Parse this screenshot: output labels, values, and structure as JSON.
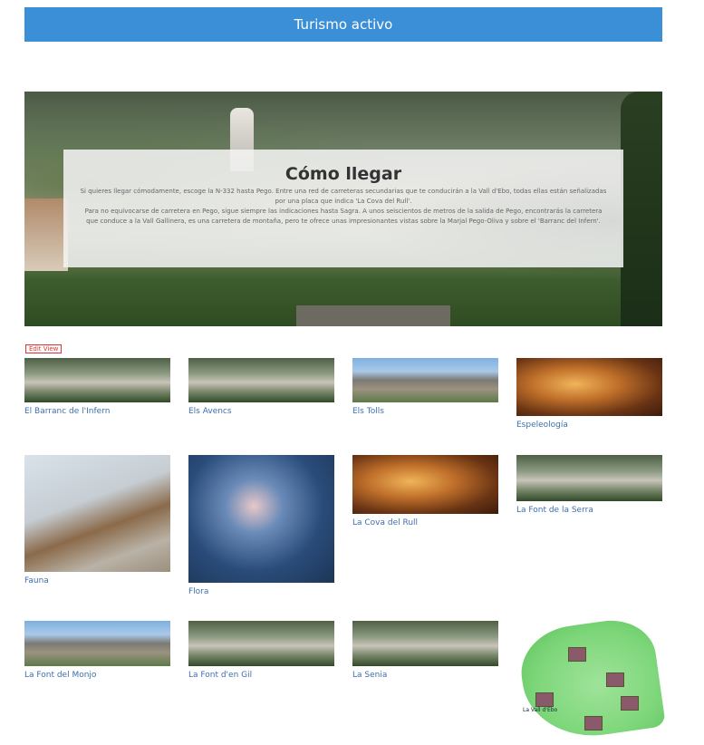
{
  "header": {
    "title": "Turismo activo"
  },
  "hero": {
    "title": "Cómo llegar",
    "paragraph1": "Si quieres llegar cómodamente, escoge la N-332 hasta Pego. Entre una red de carreteras secundarias que te conducirán a la Vall d'Ebo, todas ellas están señalizadas por una placa que indica 'La Cova del Rull'.",
    "paragraph2": "Para no equivocarse de carretera en Pego, sigue siempre las indicaciones hasta Sagra. A unos seiscientos de metros de la salida de Pego, encontrarás la carretera que conduce a la Vall Gallinera, es una carretera de montaña, pero te ofrece unas impresionantes vistas sobre la Marjal Pego-Oliva y sobre el 'Barranc del Infern'."
  },
  "admin": {
    "edit_label": "Edit View"
  },
  "cards": [
    {
      "label": "El Barranc de l'Infern",
      "thumb": "village"
    },
    {
      "label": "Els Avencs",
      "thumb": "village"
    },
    {
      "label": "Els Tolls",
      "thumb": "mountain"
    },
    {
      "label": "Espeleología",
      "thumb": "cave"
    },
    {
      "label": "Fauna",
      "thumb": "bird"
    },
    {
      "label": "Flora",
      "thumb": "flower"
    },
    {
      "label": "La Cova del Rull",
      "thumb": "cave"
    },
    {
      "label": "La Font de la Serra",
      "thumb": "village"
    },
    {
      "label": "La Font del Monjo",
      "thumb": "mountain"
    },
    {
      "label": "La Font d'en Gil",
      "thumb": "village"
    },
    {
      "label": "La Senia",
      "thumb": "village"
    }
  ],
  "map": {
    "label": "La Vall d'Ebo"
  }
}
